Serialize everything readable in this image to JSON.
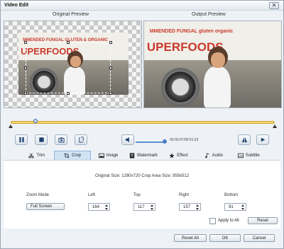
{
  "window": {
    "title": "Video Edit",
    "close_glyph": "✕"
  },
  "preview": {
    "original_label": "Original Preview",
    "output_label": "Output Preview"
  },
  "video_text": {
    "line1": "MMENDED FUNGAL GLUTEN & ORGANIC",
    "line2": "UPERFOODS"
  },
  "output_text": {
    "line1": "MMENDED FUNGAL gluten organic",
    "line2": "UPERFOODS"
  },
  "player": {
    "timecode": "00:00:07/00:01:23",
    "progress": 0.09,
    "volume": 0.9,
    "controls": [
      "play-pause",
      "stop",
      "snapshot",
      "cut"
    ],
    "right_controls": [
      "flip",
      "rotate"
    ]
  },
  "tabs": [
    {
      "label": "Trim",
      "icon": "scissors-icon"
    },
    {
      "label": "Crop",
      "icon": "crop-icon",
      "active": true
    },
    {
      "label": "Image",
      "icon": "image-icon"
    },
    {
      "label": "Watermark",
      "icon": "watermark-icon"
    },
    {
      "label": "Effect",
      "icon": "star-icon"
    },
    {
      "label": "Audio",
      "icon": "music-icon"
    },
    {
      "label": "Subtitle",
      "icon": "subtitle-icon"
    }
  ],
  "crop": {
    "size_info": "Original Size: 1280x720  Crop Area Size: 959x512",
    "zoom_mode_label": "Zoom Mode",
    "zoom_mode_value": "Full Screen",
    "left_label": "Left",
    "left_value": "164",
    "top_label": "Top",
    "top_value": "117",
    "right_label": "Right",
    "right_value": "157",
    "bottom_label": "Bottom",
    "bottom_value": "91",
    "apply_to_all": "Apply to All",
    "reset": "Reset"
  },
  "footer": {
    "reset_all": "Reset All",
    "ok": "OK",
    "cancel": "Cancel"
  },
  "colors": {
    "accent": "#5b8fd6",
    "timeline": "#f5d56a",
    "tab_active": "#cfe3f5"
  }
}
